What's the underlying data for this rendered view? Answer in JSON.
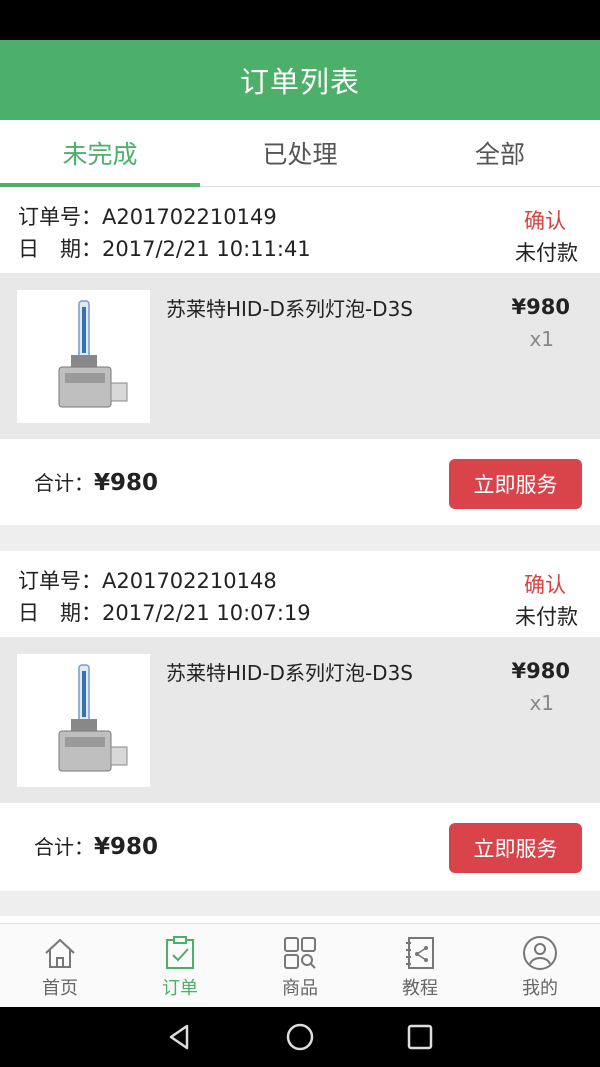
{
  "header": {
    "title": "订单列表"
  },
  "tabs": [
    {
      "label": "未完成",
      "active": true
    },
    {
      "label": "已处理",
      "active": false
    },
    {
      "label": "全部",
      "active": false
    }
  ],
  "orders": [
    {
      "order_no": "订单号：A201702210149",
      "date": "日　期：2017/2/21 10:11:41",
      "confirm": "确认",
      "pay_status": "未付款",
      "item_name": "苏莱特HID-D系列灯泡-D3S",
      "price": "¥980",
      "qty": "x1",
      "total_label": "合计：",
      "total": "¥980",
      "action": "立即服务"
    },
    {
      "order_no": "订单号：A201702210148",
      "date": "日　期：2017/2/21 10:07:19",
      "confirm": "确认",
      "pay_status": "未付款",
      "item_name": "苏莱特HID-D系列灯泡-D3S",
      "price": "¥980",
      "qty": "x1",
      "total_label": "合计：",
      "total": "¥980",
      "action": "立即服务"
    }
  ],
  "bottom_nav": [
    {
      "label": "首页",
      "icon": "home-icon"
    },
    {
      "label": "订单",
      "icon": "order-icon",
      "active": true
    },
    {
      "label": "商品",
      "icon": "products-icon"
    },
    {
      "label": "教程",
      "icon": "tutorial-icon"
    },
    {
      "label": "我的",
      "icon": "profile-icon"
    }
  ],
  "colors": {
    "primary": "#4caf6a",
    "accent": "#d9434a"
  }
}
